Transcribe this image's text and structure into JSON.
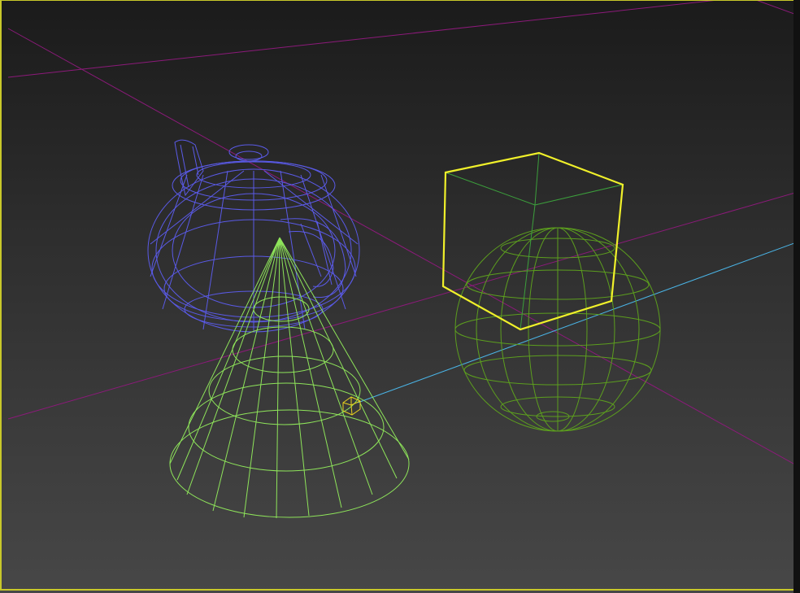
{
  "viewport": {
    "active_border_color": "#c8c82a",
    "background_top": "#1b1b1b",
    "background_bottom": "#474747"
  },
  "scene": {
    "objects": [
      {
        "name": "teapot",
        "color": "#5a5ae6",
        "selected": false
      },
      {
        "name": "cone",
        "color": "#8ee45a",
        "selected": false
      },
      {
        "name": "sphere",
        "color": "#5c9e1e",
        "selected": false
      },
      {
        "name": "box",
        "color": "#f0f02a",
        "selected": true,
        "edge_color": "#3ca03c"
      },
      {
        "name": "dummy-helper",
        "color": "#e8d21e",
        "selected": false
      }
    ],
    "axes": {
      "x_color": "#8c1a7a",
      "y_color": "#8c1a7a",
      "z_color": "#4ab4e6"
    }
  }
}
